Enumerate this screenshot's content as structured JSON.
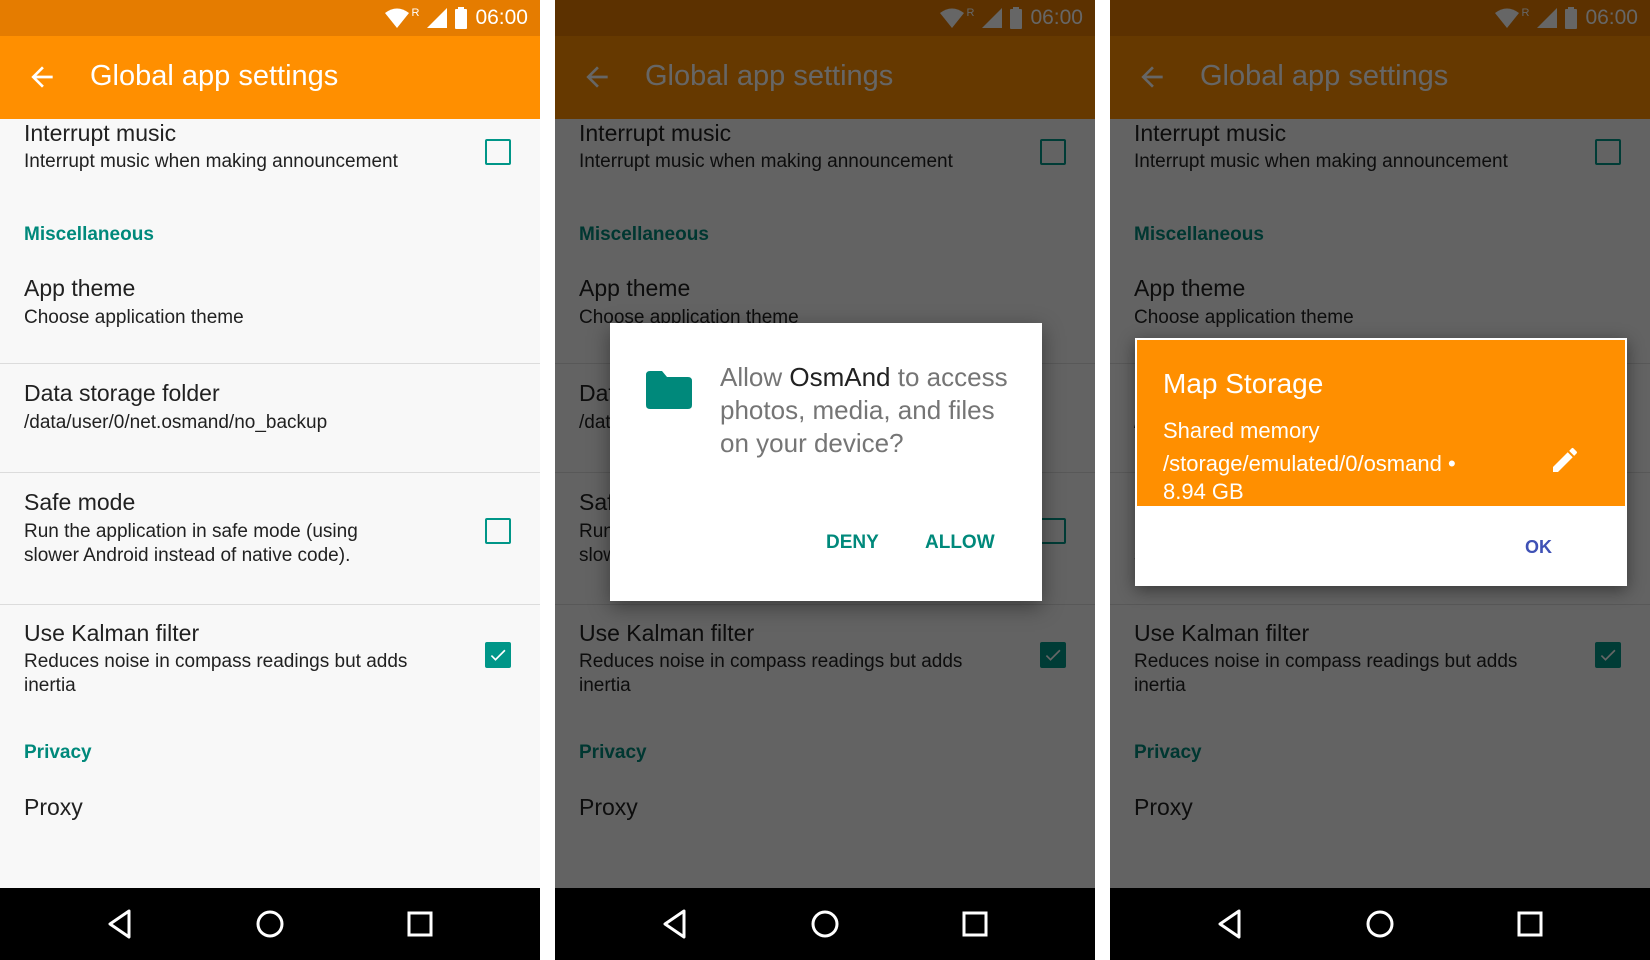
{
  "status_bar": {
    "time": "06:00",
    "roaming": "R"
  },
  "app_bar": {
    "title": "Global app settings"
  },
  "settings": {
    "interrupt_music": {
      "title": "Interrupt music",
      "summary": "Interrupt music when making announcement",
      "checked": false
    },
    "misc_header": "Miscellaneous",
    "app_theme": {
      "title": "App theme",
      "summary": "Choose application theme"
    },
    "data_storage": {
      "title": "Data storage folder",
      "summary": "/data/user/0/net.osmand/no_backup"
    },
    "safe_mode": {
      "title": "Safe mode",
      "summary": "Run the application in safe mode (using slower Android instead of native code).",
      "checked": false
    },
    "kalman": {
      "title": "Use Kalman filter",
      "summary": "Reduces noise in compass readings but adds inertia",
      "checked": true
    },
    "privacy_header": "Privacy",
    "proxy": {
      "title": "Proxy"
    }
  },
  "permission_dialog": {
    "text_before": "Allow ",
    "app_name": "OsmAnd",
    "text_after": " to access photos, media, and files on your device?",
    "deny": "DENY",
    "allow": "ALLOW"
  },
  "storage_dialog": {
    "title": "Map Storage",
    "subtitle": "Shared memory",
    "path": "/storage/emulated/0/osmand •",
    "size": "8.94 GB",
    "ok": "OK"
  },
  "colors": {
    "app_bar": "#ff8f00",
    "status_bar": "#e57c00",
    "accent": "#009688",
    "section_header": "#00897b",
    "ok_button": "#3f51b5"
  },
  "icons": {
    "back": "arrow-left-icon",
    "folder": "folder-icon",
    "edit": "pencil-icon",
    "nav": [
      "back-triangle-icon",
      "home-circle-icon",
      "recents-square-icon"
    ]
  }
}
